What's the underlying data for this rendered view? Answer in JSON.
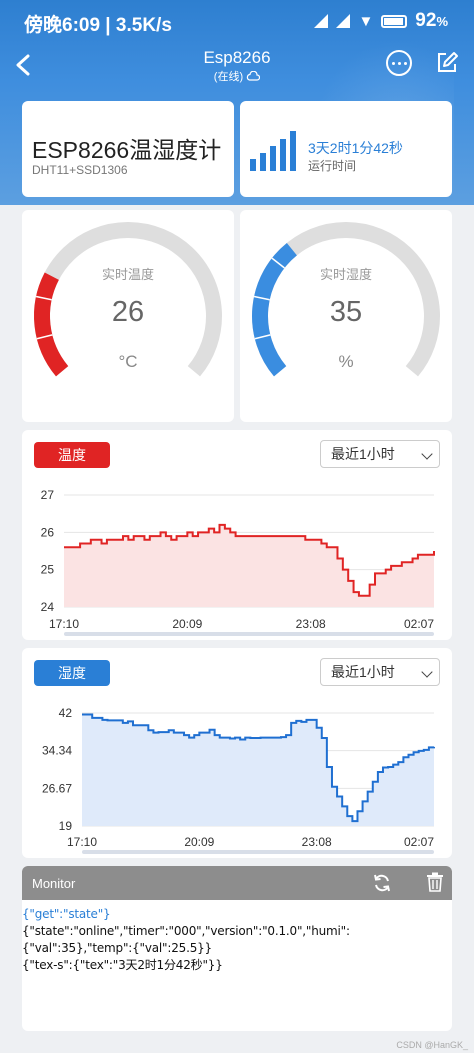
{
  "statusbar": {
    "time": "傍晚6:09 | 3.5K/s",
    "battery": "92"
  },
  "nav": {
    "title": "Esp8266",
    "subtitle": "(在线)"
  },
  "title_card": {
    "title": "ESP8266温湿度计",
    "subtitle": "DHT11+SSD1306"
  },
  "runtime": {
    "value": "3天2时1分42秒",
    "label": "运行时间"
  },
  "gauges": [
    {
      "label": "实时温度",
      "value": "26",
      "unit": "°C",
      "level": 0.26,
      "color": "#e02424"
    },
    {
      "label": "实时湿度",
      "value": "35",
      "unit": "%",
      "level": 0.35,
      "color": "#3a8de0"
    }
  ],
  "charts": [
    {
      "badge": "温度",
      "range": "最近1小时",
      "color": "#e02424",
      "fill": "#fbe3e3",
      "badge_color": "#e02424"
    },
    {
      "badge": "湿度",
      "range": "最近1小时",
      "color": "#1f6fd1",
      "fill": "#dfeafa",
      "badge_color": "#2a7fd6"
    }
  ],
  "chart_data": [
    {
      "type": "line",
      "series": [
        {
          "name": "温度",
          "values": [
            25.6,
            25.6,
            25.6,
            25.7,
            25.7,
            25.8,
            25.8,
            25.7,
            25.8,
            25.8,
            25.8,
            25.9,
            25.8,
            25.9,
            25.9,
            25.8,
            25.9,
            25.9,
            26.0,
            25.9,
            25.8,
            25.9,
            25.9,
            26.0,
            25.9,
            26.0,
            26.0,
            26.1,
            26.0,
            26.2,
            26.1,
            26.0,
            25.9,
            25.9,
            25.9,
            25.9,
            25.9,
            25.9,
            25.9,
            25.9,
            25.9,
            25.9,
            25.9,
            25.9,
            25.9,
            25.8,
            25.8,
            25.8,
            25.7,
            25.6,
            25.6,
            25.3,
            25.0,
            24.7,
            24.4,
            24.3,
            24.3,
            24.6,
            24.9,
            24.9,
            25.0,
            25.1,
            25.1,
            25.2,
            25.2,
            25.3,
            25.4,
            25.4,
            25.4,
            25.5
          ]
        }
      ],
      "x_ticks": [
        "17:10",
        "20:09",
        "23:08",
        "02:07"
      ],
      "y_ticks": [
        "27",
        "26",
        "25",
        "24"
      ],
      "ylim": [
        24,
        27
      ]
    },
    {
      "type": "line",
      "series": [
        {
          "name": "湿度",
          "values": [
            41.7,
            41.7,
            41.0,
            41.0,
            40.6,
            40.5,
            40.5,
            40.5,
            40.0,
            40.3,
            39.5,
            39.5,
            39.5,
            38.5,
            38.0,
            38.1,
            38.1,
            38.5,
            38.0,
            38.0,
            37.5,
            37.0,
            37.5,
            38.0,
            38.0,
            38.6,
            37.5,
            37.0,
            37.0,
            36.8,
            37.0,
            36.6,
            37.0,
            36.9,
            36.9,
            37.0,
            37.0,
            37.0,
            37.0,
            37.1,
            37.5,
            40.0,
            40.4,
            40.2,
            40.6,
            40.6,
            39.0,
            36.9,
            31.0,
            27.0,
            25.0,
            23.0,
            21.0,
            20.0,
            22.0,
            24.0,
            26.0,
            28.0,
            30.0,
            30.9,
            31.0,
            31.5,
            32.0,
            33.0,
            33.5,
            34.0,
            34.3,
            34.5,
            35.0,
            35.1
          ]
        }
      ],
      "x_ticks": [
        "17:10",
        "20:09",
        "23:08",
        "02:07"
      ],
      "y_ticks": [
        "42",
        "34.34",
        "26.67",
        "19"
      ],
      "ylim": [
        19,
        42
      ]
    }
  ],
  "monitor": {
    "title": "Monitor",
    "line1": "{\"get\":\"state\"}",
    "line2": "{\"state\":\"online\",\"timer\":\"000\",\"version\":\"0.1.0\",\"humi\":{\"val\":35},\"temp\":{\"val\":25.5}}",
    "line3": "{\"tex-s\":{\"tex\":\"3天2时1分42秒\"}}"
  },
  "watermark": "CSDN @HanGK_",
  "icons": [
    "back-arrow-icon",
    "cloud-icon",
    "more-icon",
    "edit-icon",
    "signal-bars-icon",
    "refresh-icon",
    "trash-icon"
  ]
}
